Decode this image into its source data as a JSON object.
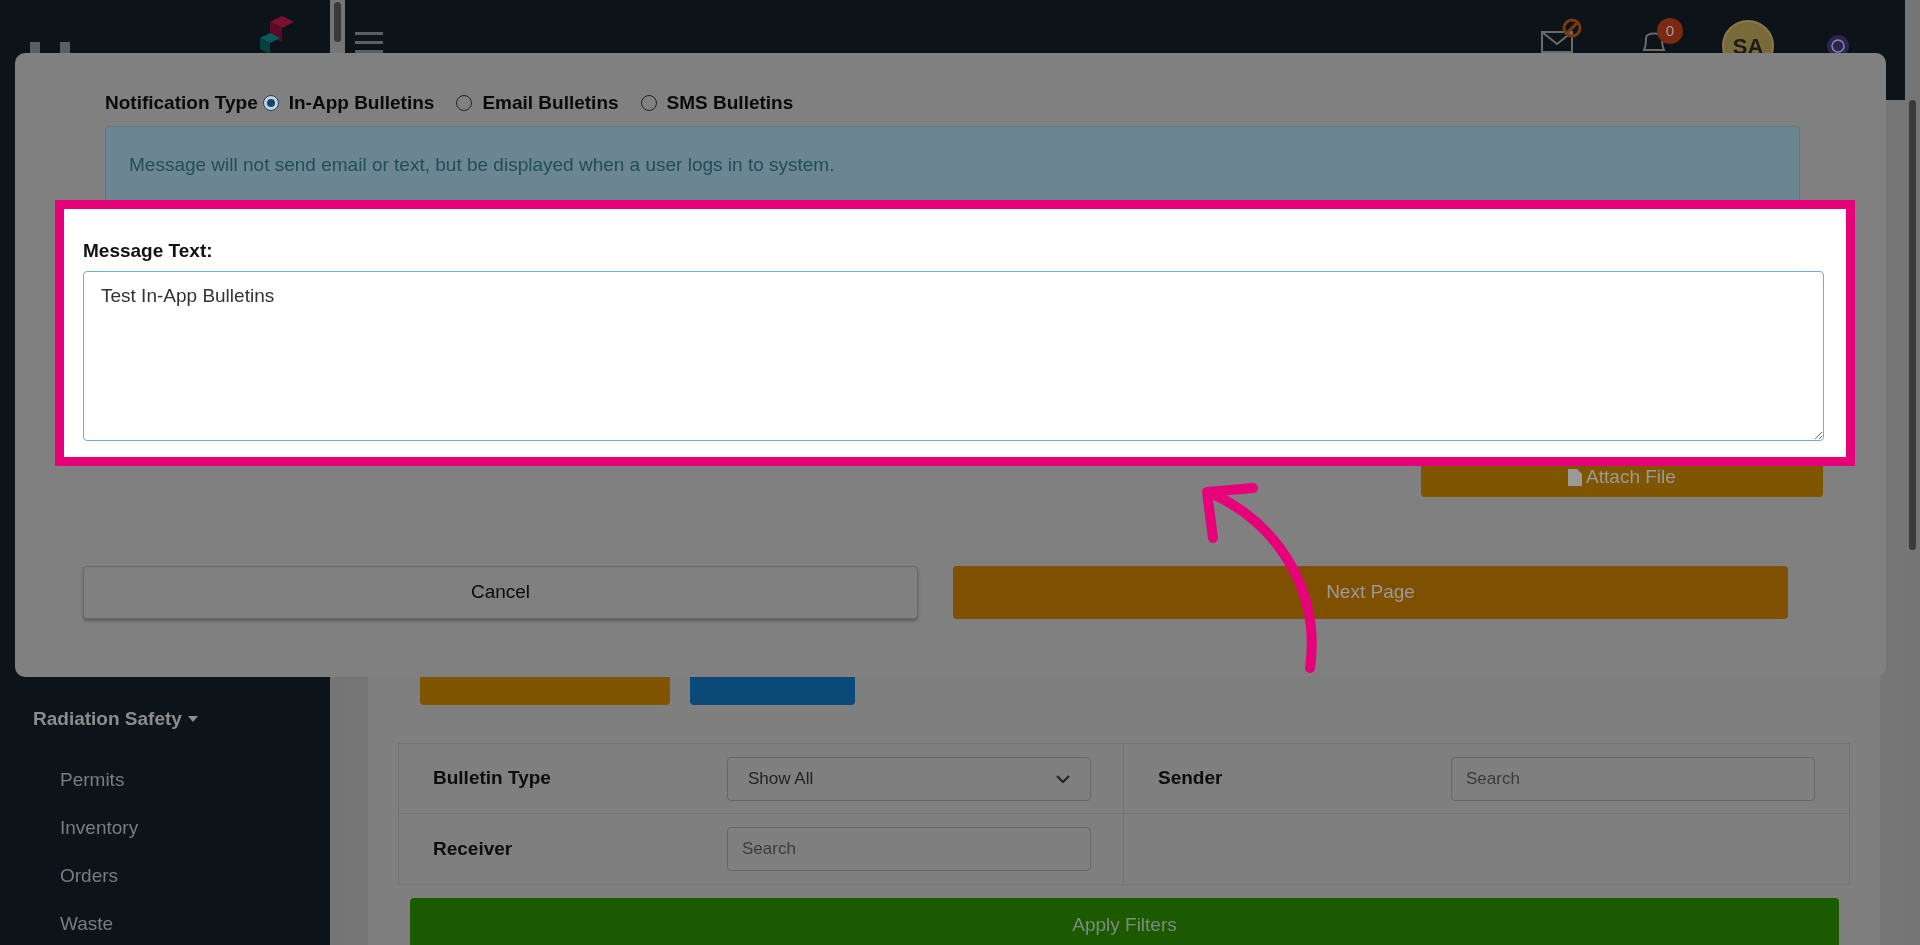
{
  "header": {
    "notification_count": "0",
    "avatar": "SA"
  },
  "sidebar": {
    "section": {
      "label": "Radiation Safety",
      "expanded": true
    },
    "items": [
      {
        "label": "Permits"
      },
      {
        "label": "Inventory"
      },
      {
        "label": "Orders"
      },
      {
        "label": "Waste"
      }
    ]
  },
  "page": {
    "buttons": [
      {
        "kind": "primary"
      },
      {
        "kind": "secondary"
      }
    ],
    "filters": {
      "bulletin_type": {
        "label": "Bulletin Type",
        "value": "Show All"
      },
      "sender": {
        "label": "Sender",
        "placeholder": "Search"
      },
      "receiver": {
        "label": "Receiver",
        "placeholder": "Search"
      },
      "apply": "Apply Filters"
    }
  },
  "modal": {
    "notification_type": {
      "label": "Notification Type",
      "options": [
        {
          "label": "In-App Bulletins",
          "selected": true
        },
        {
          "label": "Email Bulletins",
          "selected": false
        },
        {
          "label": "SMS Bulletins",
          "selected": false
        }
      ]
    },
    "info": "Message will not send email or text, but be displayed when a user logs in to system.",
    "message": {
      "label": "Message Text:",
      "value": "Test In-App Bulletins"
    },
    "attach": "Attach File",
    "cancel": "Cancel",
    "next": "Next Page"
  }
}
